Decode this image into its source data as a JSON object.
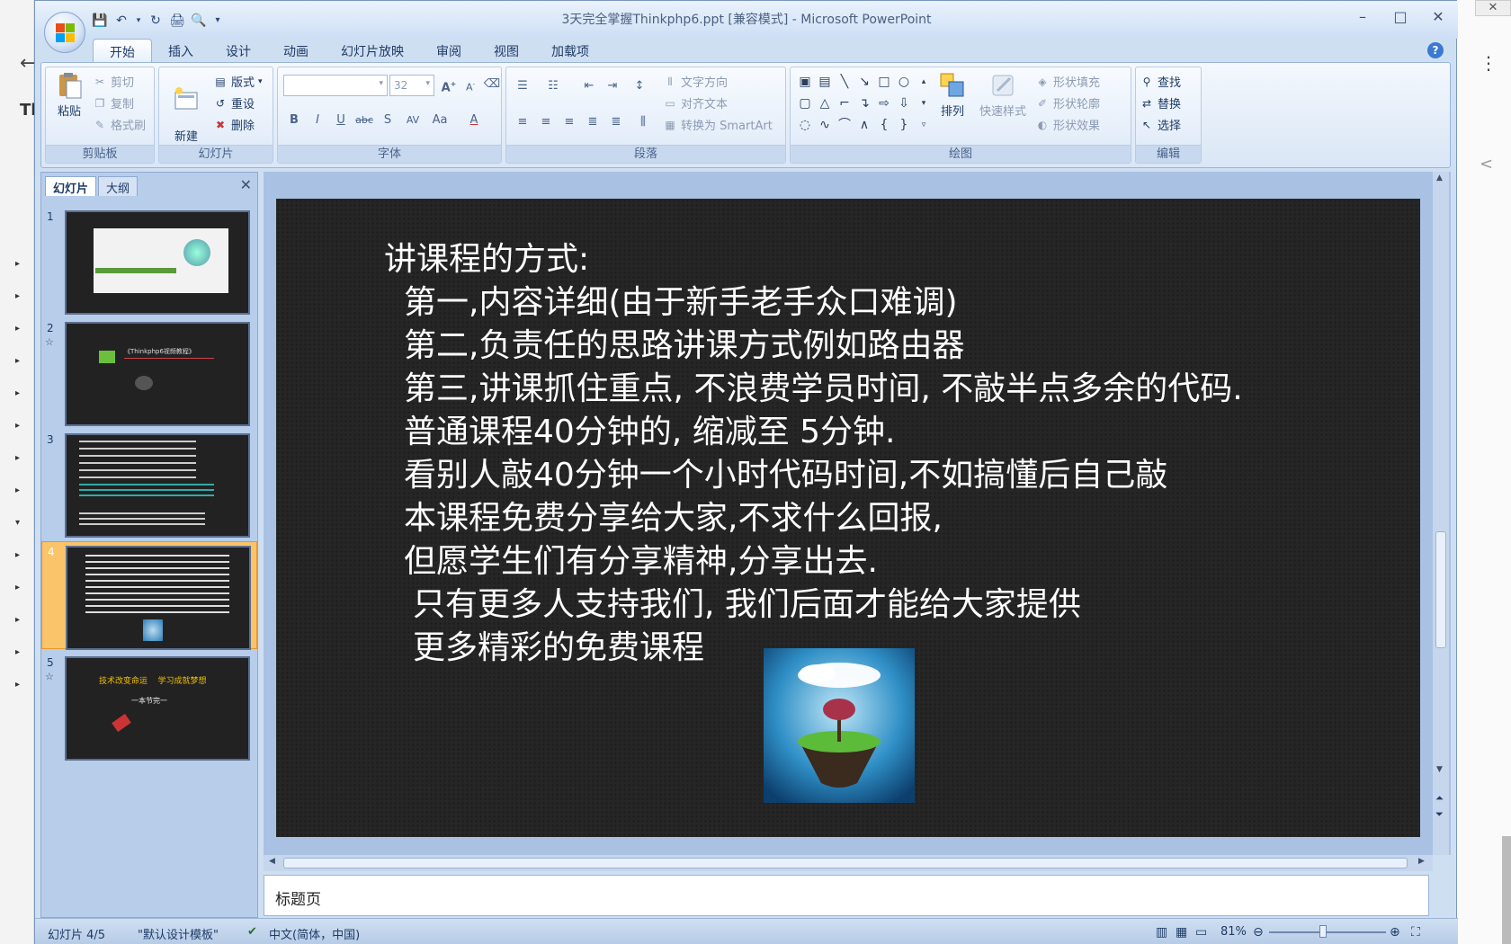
{
  "background": {
    "left_arrows": 14,
    "back_glyph": "←",
    "title_fragment": "Th",
    "right_close": "✕",
    "right_menu": "⋮"
  },
  "window": {
    "title": "3天完全掌握Thinkphp6.ppt [兼容模式] - Microsoft PowerPoint",
    "minimize": "–",
    "maximize": "□",
    "close": "✕"
  },
  "tabs": [
    "开始",
    "插入",
    "设计",
    "动画",
    "幻灯片放映",
    "审阅",
    "视图",
    "加载项"
  ],
  "ribbon": {
    "clipboard": {
      "label": "剪贴板",
      "paste": "粘贴",
      "cut": "剪切",
      "copy": "复制",
      "format_painter": "格式刷"
    },
    "slides": {
      "label": "幻灯片",
      "new_slide": "新建\n幻灯片",
      "layout": "版式",
      "reset": "重设",
      "delete": "删除"
    },
    "font": {
      "label": "字体",
      "font_name": "",
      "font_size": "32"
    },
    "paragraph": {
      "label": "段落",
      "text_direction": "文字方向",
      "align_text": "对齐文本",
      "smartart": "转换为 SmartArt"
    },
    "drawing": {
      "label": "绘图",
      "arrange": "排列",
      "quick_styles": "快速样式",
      "shape_fill": "形状填充",
      "shape_outline": "形状轮廓",
      "shape_effects": "形状效果"
    },
    "editing": {
      "label": "编辑",
      "find": "查找",
      "replace": "替换",
      "select": "选择"
    }
  },
  "left_panel": {
    "tab_slides": "幻灯片",
    "tab_outline": "大纲",
    "slides": [
      {
        "num": "1",
        "star": false,
        "selected": false
      },
      {
        "num": "2",
        "star": true,
        "selected": false,
        "caption": "《Thinkphp6视频教程》"
      },
      {
        "num": "3",
        "star": false,
        "selected": false
      },
      {
        "num": "4",
        "star": false,
        "selected": true
      },
      {
        "num": "5",
        "star": true,
        "selected": false,
        "caption": "技术改变命运    学习成就梦想",
        "subcaption": "一本节完一"
      }
    ]
  },
  "slide": {
    "lines": [
      "讲课程的方式:",
      "第一,内容详细(由于新手老手众口难调)",
      "第二,负责任的思路讲课方式例如路由器",
      "第三,讲课抓住重点, 不浪费学员时间,  不敲半点多余的代码.",
      "普通课程40分钟的, 缩减至 5分钟.",
      "看别人敲40分钟一个小时代码时间,不如搞懂后自己敲",
      "本课程免费分享给大家,不求什么回报,",
      "但愿学生们有分享精神,分享出去.",
      "只有更多人支持我们, 我们后面才能给大家提供",
      "更多精彩的免费课程"
    ]
  },
  "notes": "标题页",
  "status": {
    "slide_counter": "幻灯片 4/5",
    "theme": "\"默认设计模板\"",
    "language": "中文(简体，中国)",
    "zoom": "81%"
  }
}
